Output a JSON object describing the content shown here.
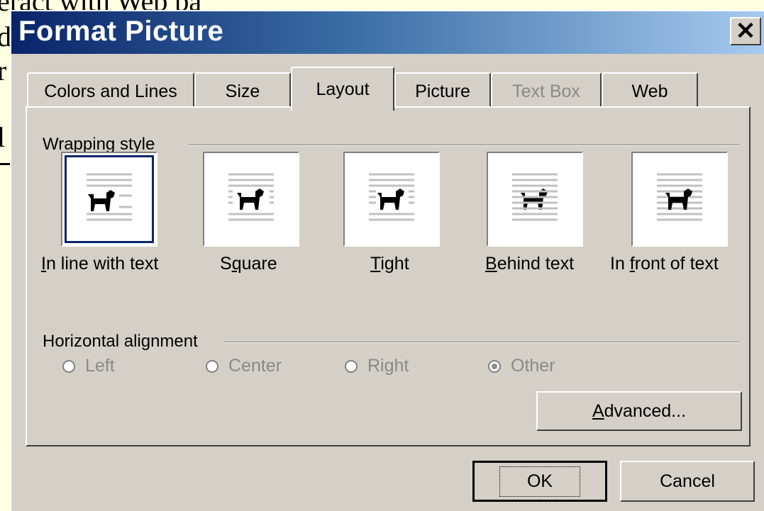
{
  "background_doc": {
    "lines": [
      "eract with Web ba",
      "d",
      "r",
      "",
      "l"
    ]
  },
  "dialog": {
    "title": "Format Picture",
    "close_label": "✕"
  },
  "tabs": [
    {
      "label": "Colors and Lines",
      "state": "normal"
    },
    {
      "label": "Size",
      "state": "normal"
    },
    {
      "label": "Layout",
      "state": "active"
    },
    {
      "label": "Picture",
      "state": "normal"
    },
    {
      "label": "Text Box",
      "state": "disabled"
    },
    {
      "label": "Web",
      "state": "normal"
    }
  ],
  "wrapping": {
    "group_label": "Wrapping style",
    "options": [
      {
        "label": "In line with text",
        "accel": "I",
        "selected": true,
        "icon": "inline-wrap-icon"
      },
      {
        "label": "Square",
        "accel": "q",
        "selected": false,
        "icon": "square-wrap-icon"
      },
      {
        "label": "Tight",
        "accel": "T",
        "selected": false,
        "icon": "tight-wrap-icon"
      },
      {
        "label": "Behind text",
        "accel": "B",
        "selected": false,
        "icon": "behind-text-icon"
      },
      {
        "label": "In front of text",
        "accel": "f",
        "selected": false,
        "icon": "in-front-text-icon"
      }
    ]
  },
  "alignment": {
    "group_label": "Horizontal alignment",
    "options": [
      {
        "label": "Left",
        "checked": false,
        "enabled": false
      },
      {
        "label": "Center",
        "checked": false,
        "enabled": false
      },
      {
        "label": "Right",
        "checked": false,
        "enabled": false
      },
      {
        "label": "Other",
        "checked": true,
        "enabled": false
      }
    ]
  },
  "buttons": {
    "advanced": "Advanced...",
    "ok": "OK",
    "cancel": "Cancel"
  },
  "colors": {
    "title_gradient_start": "#0a246a",
    "title_gradient_end": "#a6caf0",
    "dialog_face": "#d4d0c8",
    "background_page": "#ffffe1"
  }
}
